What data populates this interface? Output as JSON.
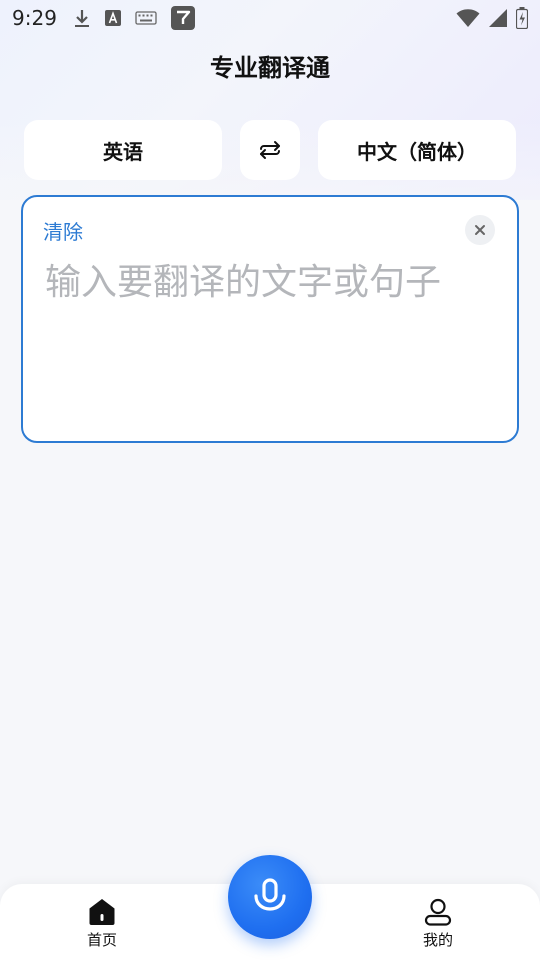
{
  "status_bar": {
    "time": "9:29",
    "left_icons": [
      "download-icon",
      "font-a-icon",
      "keyboard-icon",
      "app-y-icon"
    ],
    "right_icons": [
      "wifi-icon",
      "signal-icon",
      "battery-icon"
    ]
  },
  "header": {
    "title": "专业翻译通"
  },
  "language_bar": {
    "source_language": "英语",
    "swap_icon": "swap-arrows-icon",
    "target_language": "中文（简体）"
  },
  "input_card": {
    "clear_label": "清除",
    "close_icon": "close-icon",
    "value": "",
    "placeholder": "输入要翻译的文字或句子"
  },
  "bottom_nav": {
    "items": [
      {
        "label": "首页",
        "icon": "home-icon",
        "active": true
      },
      {
        "label": "我的",
        "icon": "user-icon",
        "active": false
      }
    ],
    "mic_icon": "microphone-icon"
  },
  "colors": {
    "accent": "#2d7bd3",
    "mic_blue": "#1f6ff0",
    "background": "#f6f7fa"
  }
}
